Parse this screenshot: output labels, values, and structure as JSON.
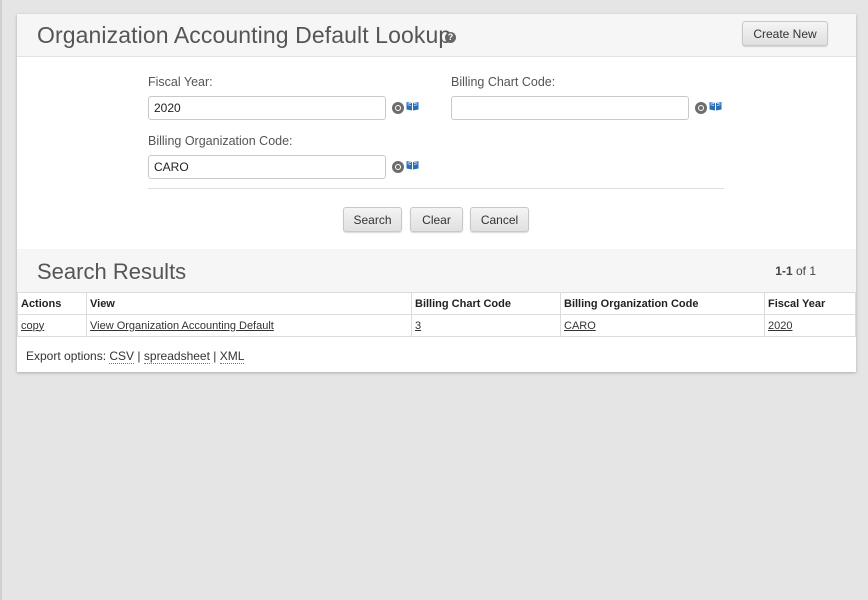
{
  "header": {
    "title": "Organization Accounting Default Lookup",
    "help_icon": "question-circle-icon",
    "create_new_label": "Create New"
  },
  "form": {
    "fiscal_year": {
      "label": "Fiscal Year:",
      "value": "2020"
    },
    "billing_chart_code": {
      "label": "Billing Chart Code:",
      "value": ""
    },
    "billing_org_code": {
      "label": "Billing Organization Code:",
      "value": "CARO"
    },
    "buttons": {
      "search": "Search",
      "clear": "Clear",
      "cancel": "Cancel"
    }
  },
  "results": {
    "title": "Search Results",
    "pager_range": "1-1",
    "pager_of": "of 1",
    "columns": [
      "Actions",
      "View",
      "Billing Chart Code",
      "Billing Organization Code",
      "Fiscal Year"
    ],
    "rows": [
      {
        "action": "copy",
        "view": "View Organization Accounting Default",
        "chart_code": "3",
        "org_code": "CARO",
        "fiscal_year": "2020"
      }
    ],
    "export": {
      "label": "Export options:",
      "csv": "CSV",
      "spreadsheet": "spreadsheet",
      "xml": "XML",
      "separator": "|"
    }
  },
  "colors": {
    "page_bg": "#e5e5e5",
    "panel_bg": "#ffffff",
    "header_bg": "#f6f6f6",
    "book_icon": "#2a6eb8"
  }
}
